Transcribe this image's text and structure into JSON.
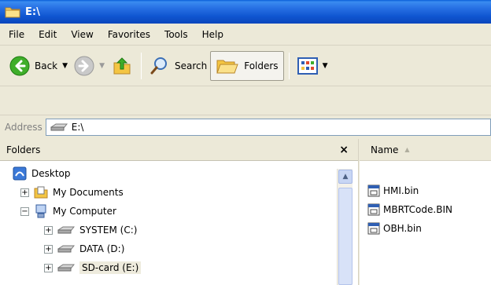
{
  "window": {
    "title": "E:\\"
  },
  "menu": [
    "File",
    "Edit",
    "View",
    "Favorites",
    "Tools",
    "Help"
  ],
  "toolbar": {
    "back_label": "Back",
    "search_label": "Search",
    "folders_label": "Folders"
  },
  "address": {
    "label": "Address",
    "value": "E:\\"
  },
  "folders_pane": {
    "title": "Folders",
    "close_glyph": "×",
    "tree": [
      {
        "label": "Desktop",
        "indent": 0,
        "icon": "desktop-icon"
      },
      {
        "label": "My Documents",
        "indent": 1,
        "expander": "+",
        "icon": "my-documents-icon"
      },
      {
        "label": "My Computer",
        "indent": 1,
        "expander": "−",
        "icon": "my-computer-icon"
      },
      {
        "label": "SYSTEM (C:)",
        "indent": 2,
        "expander": "+",
        "icon": "drive-icon"
      },
      {
        "label": "DATA (D:)",
        "indent": 2,
        "expander": "+",
        "icon": "drive-icon"
      },
      {
        "label": "SD-card (E:)",
        "indent": 2,
        "expander": "+",
        "icon": "drive-icon",
        "selected": true
      }
    ]
  },
  "files_pane": {
    "column_name": "Name",
    "files": [
      "HMI.bin",
      "MBRTCode.BIN",
      "OBH.bin"
    ]
  },
  "colors": {
    "titlebar": "#0A46BC",
    "chrome": "#ECE9D8",
    "selection": "#EEEBDD"
  }
}
